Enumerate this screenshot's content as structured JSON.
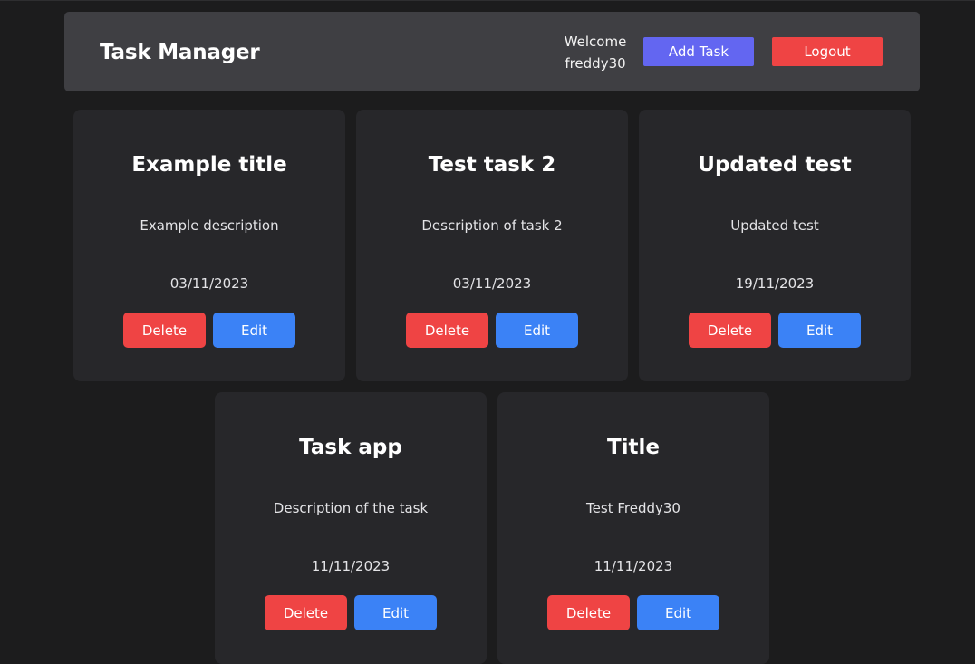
{
  "header": {
    "title": "Task Manager",
    "welcome_line1": "Welcome",
    "welcome_line2": "freddy30",
    "add_task_label": "Add Task",
    "logout_label": "Logout"
  },
  "tasks": [
    {
      "title": "Example title",
      "description": "Example description",
      "date": "03/11/2023",
      "delete_label": "Delete",
      "edit_label": "Edit"
    },
    {
      "title": "Test task 2",
      "description": "Description of task 2",
      "date": "03/11/2023",
      "delete_label": "Delete",
      "edit_label": "Edit"
    },
    {
      "title": "Updated test",
      "description": "Updated test",
      "date": "19/11/2023",
      "delete_label": "Delete",
      "edit_label": "Edit"
    },
    {
      "title": "Task app",
      "description": "Description of the task",
      "date": "11/11/2023",
      "delete_label": "Delete",
      "edit_label": "Edit"
    },
    {
      "title": "Title",
      "description": "Test Freddy30",
      "date": "11/11/2023",
      "delete_label": "Delete",
      "edit_label": "Edit"
    }
  ],
  "colors": {
    "background": "#1c1c1d",
    "navbar": "#3f3f43",
    "card": "#27272a",
    "primary": "#6366f1",
    "danger": "#ef4444",
    "edit": "#3b82f6"
  }
}
